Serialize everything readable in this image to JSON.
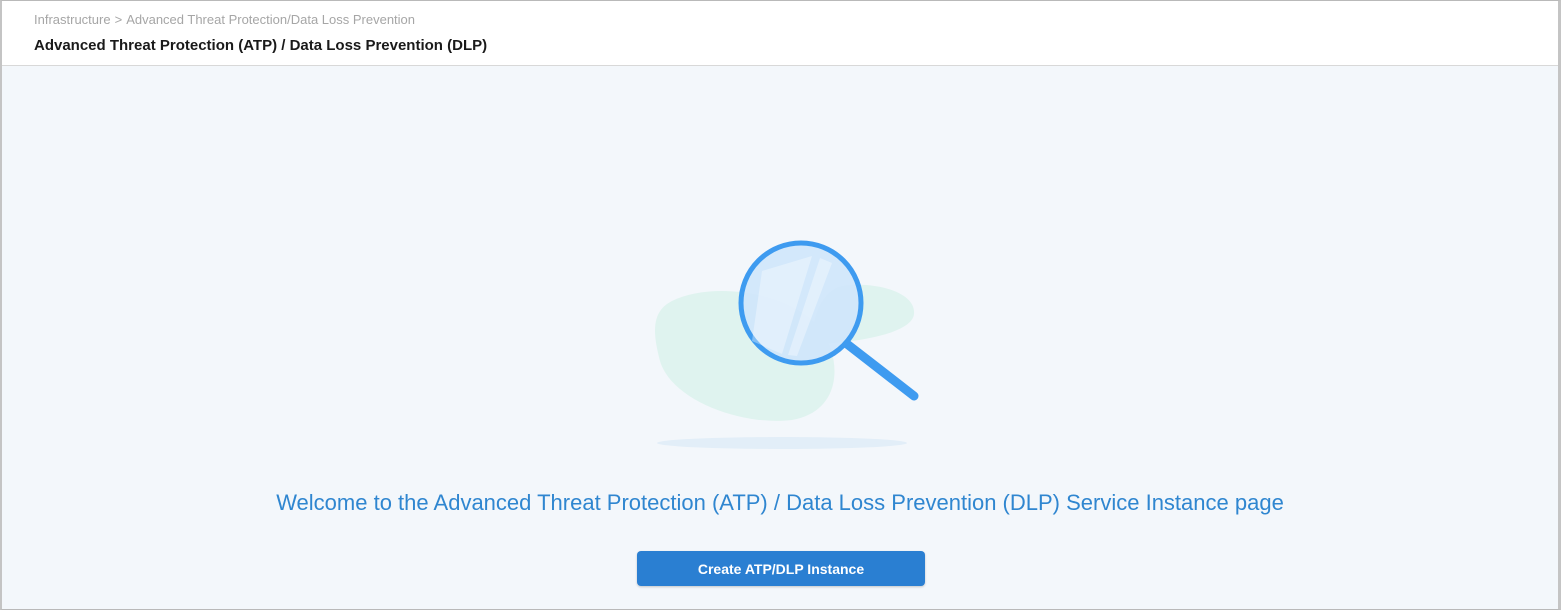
{
  "header": {
    "breadcrumb": {
      "root": "Infrastructure",
      "separator": ">",
      "current": "Advanced Threat Protection/Data Loss Prevention"
    },
    "title": "Advanced Threat Protection (ATP) / Data Loss Prevention (DLP)"
  },
  "empty_state": {
    "icon": "magnifying-glass-icon",
    "message": "Welcome to the Advanced Threat Protection (ATP) / Data Loss Prevention (DLP) Service Instance page",
    "button_label": "Create ATP/DLP Instance"
  },
  "colors": {
    "accent": "#2a7fd2",
    "welcome_text": "#2f86d0",
    "background": "#f3f7fb",
    "blob": "#dff3ef",
    "magnifier_stroke": "#3e9bf0",
    "lens_fill": "#cfe6fb"
  }
}
